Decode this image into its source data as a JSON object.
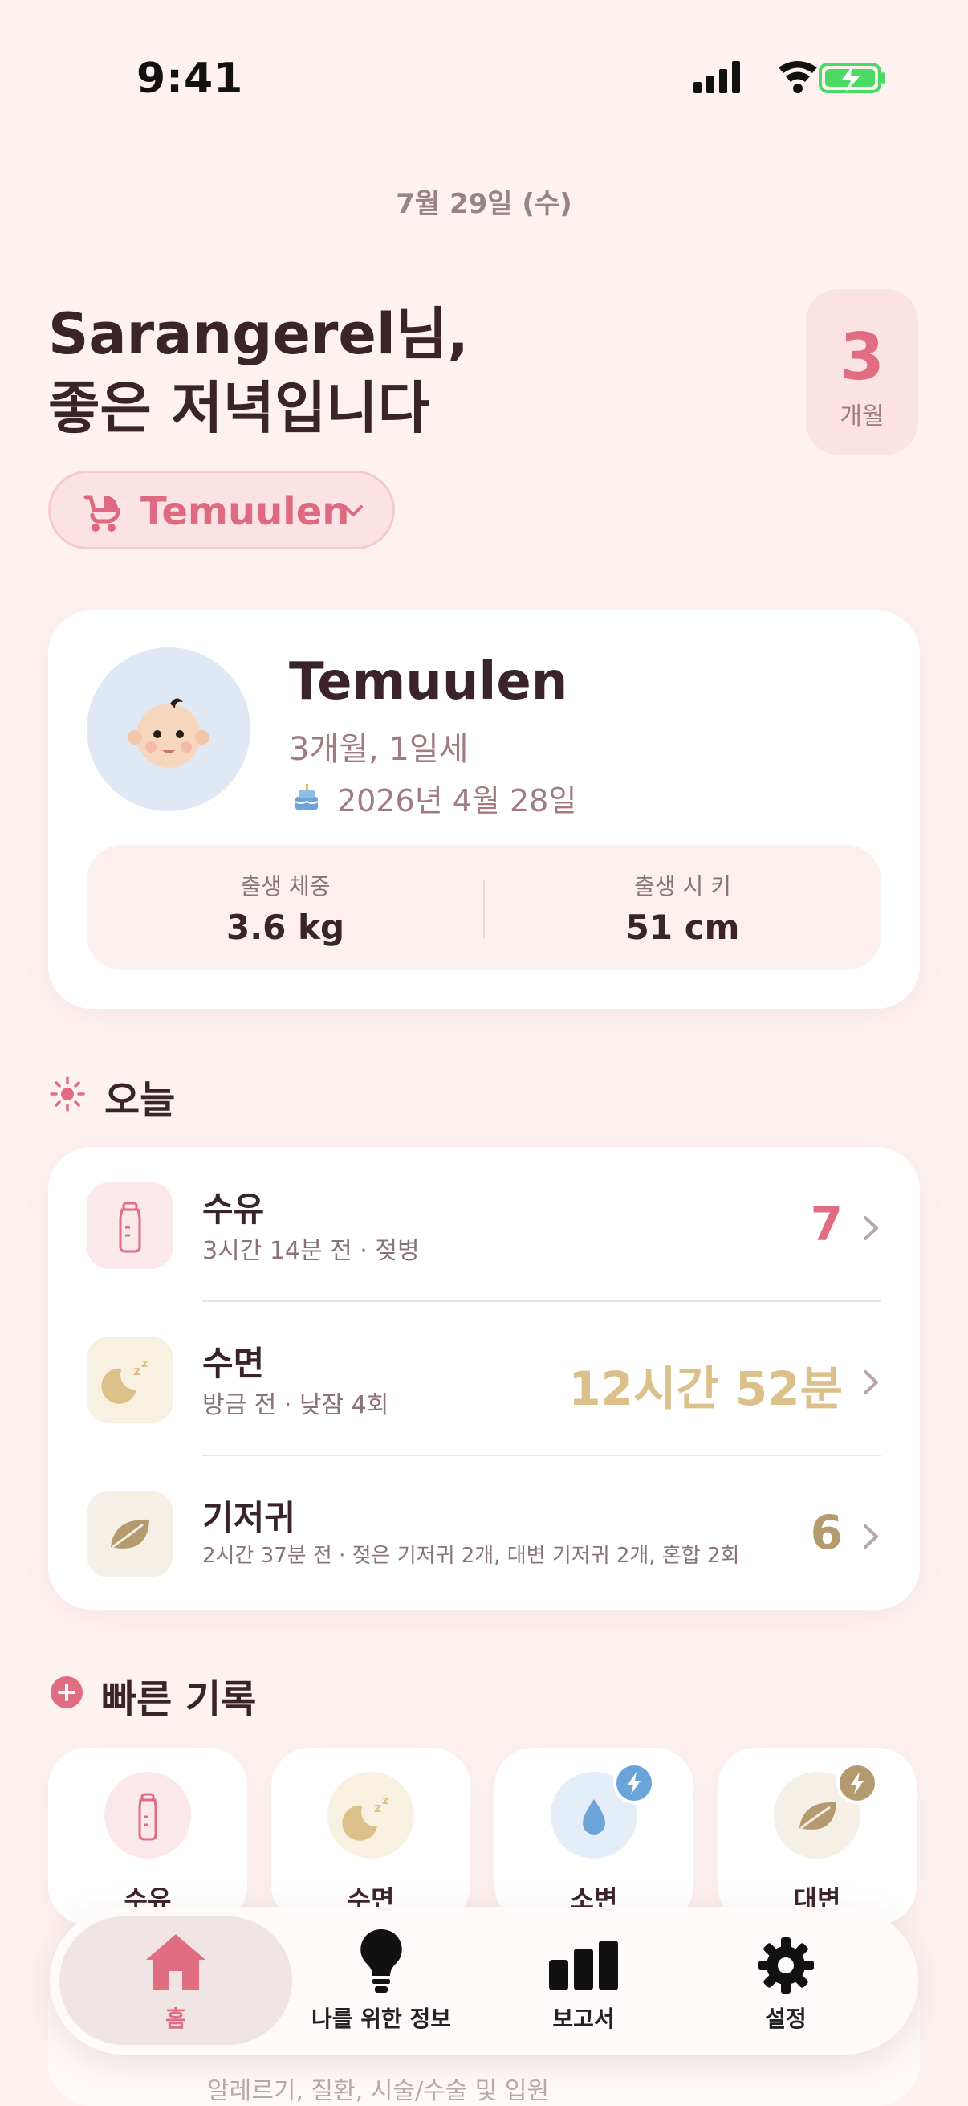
{
  "status_bar": {
    "time": "9:41"
  },
  "header": {
    "date": "7월 29일 (수)",
    "greeting_line1": "Sarangerel님,",
    "greeting_line2": "좋은 저녁입니다",
    "age_badge": {
      "value": "3",
      "unit": "개월"
    },
    "child_selector": "Temuulen"
  },
  "profile": {
    "name": "Temuulen",
    "age": "3개월, 1일세",
    "birthday": "2026년 4월 28일",
    "stats": [
      {
        "label": "출생 체중",
        "value": "3.6 kg"
      },
      {
        "label": "출생 시 키",
        "value": "51 cm"
      }
    ]
  },
  "today": {
    "title": "오늘",
    "rows": [
      {
        "title": "수유",
        "subtitle": "3시간 14분 전 · 젖병",
        "value": "7",
        "color": "#e06d82",
        "icon": "bottle-icon"
      },
      {
        "title": "수면",
        "subtitle": "방금 전 · 낮잠 4회",
        "value": "12시간 52분",
        "color": "#dcc08a",
        "icon": "moon-icon"
      },
      {
        "title": "기저귀",
        "subtitle": "2시간 37분 전 · 젖은 기저귀 2개, 대변 기저귀 2개, 혼합 2회",
        "value": "6",
        "color": "#b59a70",
        "icon": "leaf-icon"
      }
    ]
  },
  "quick_log": {
    "title": "빠른 기록",
    "buttons": [
      {
        "label": "수유",
        "icon": "bottle-icon"
      },
      {
        "label": "수면",
        "icon": "moon-icon"
      },
      {
        "label": "소변",
        "icon": "drop-icon",
        "badge": "bolt-icon"
      },
      {
        "label": "대변",
        "icon": "leaf-icon",
        "badge": "bolt-icon"
      }
    ]
  },
  "health_row": {
    "subtitle": "알레르기, 질환, 시술/수술 및 입원"
  },
  "tab_bar": {
    "tabs": [
      {
        "label": "홈",
        "icon": "home-icon",
        "active": true
      },
      {
        "label": "나를 위한 정보",
        "icon": "bulb-icon"
      },
      {
        "label": "보고서",
        "icon": "chart-icon"
      },
      {
        "label": "설정",
        "icon": "gear-icon"
      }
    ]
  },
  "colors": {
    "accent": "#e06d82",
    "background": "#fdf2f0",
    "sleep": "#dcc08a",
    "diaper": "#b59a70",
    "battery": "#4cd964"
  }
}
